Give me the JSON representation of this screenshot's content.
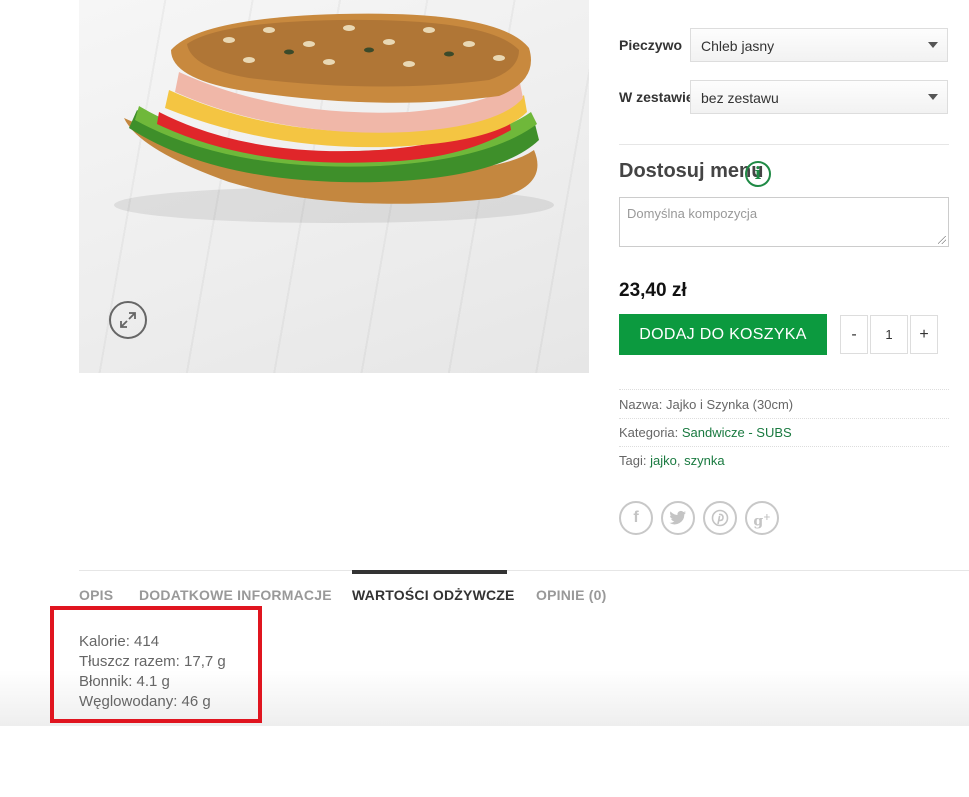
{
  "options": {
    "bread": {
      "label": "Pieczywo",
      "value": "Chleb jasny"
    },
    "set": {
      "label": "W zestawie",
      "value": "bez zestawu"
    }
  },
  "customize": {
    "title": "Dostosuj menu",
    "info_icon": "info-icon",
    "placeholder": "Domyślna kompozycja"
  },
  "price": "23,40 zł",
  "add_to_cart_label": "DODAJ DO KOSZYKA",
  "quantity": {
    "minus": "-",
    "value": "1",
    "plus": "+"
  },
  "meta": {
    "name_label": "Nazwa:",
    "name_value": "Jajko i Szynka (30cm)",
    "category_label": "Kategoria:",
    "category_value": "Sandwicze - SUBS",
    "tags_label": "Tagi:",
    "tags": [
      "jajko",
      "szynka"
    ],
    "tag_sep": ","
  },
  "share_icons": [
    "facebook-icon",
    "twitter-icon",
    "pinterest-icon",
    "google-plus-icon"
  ],
  "tabs": [
    {
      "label": "OPIS",
      "active": false
    },
    {
      "label": "DODATKOWE INFORMACJE",
      "active": false
    },
    {
      "label": "WARTOŚCI ODŻYWCZE",
      "active": true
    },
    {
      "label": "OPINIE (0)",
      "active": false
    }
  ],
  "nutrition": [
    "Kalorie: 414",
    "Tłuszcz razem: 17,7 g",
    "Błonnik: 4.1 g",
    "Węglowodany: 46 g"
  ],
  "colors": {
    "accent": "#0c9a3f",
    "link": "#1a7a40",
    "highlight": "#e0151f"
  }
}
